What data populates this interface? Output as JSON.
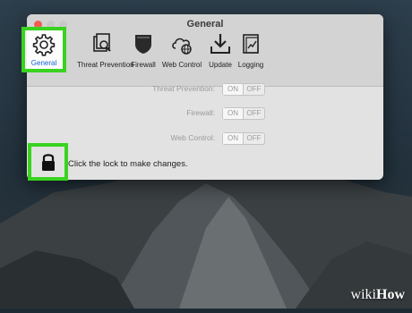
{
  "window": {
    "title": "General"
  },
  "toolbar": {
    "items": [
      {
        "label": "General",
        "icon": "gear-icon",
        "selected": true
      },
      {
        "label": "Threat Prevention",
        "icon": "magnifier-document-icon"
      },
      {
        "label": "Firewall",
        "icon": "shield-icon"
      },
      {
        "label": "Web Control",
        "icon": "cloud-globe-icon"
      },
      {
        "label": "Update",
        "icon": "download-tray-icon"
      },
      {
        "label": "Logging",
        "icon": "log-document-icon"
      }
    ]
  },
  "settings": [
    {
      "label": "Threat Prevention:",
      "on": "ON",
      "off": "OFF"
    },
    {
      "label": "Firewall:",
      "on": "ON",
      "off": "OFF"
    },
    {
      "label": "Web Control:",
      "on": "ON",
      "off": "OFF"
    }
  ],
  "lock": {
    "text": "Click the lock to make changes.",
    "icon": "lock-icon"
  },
  "watermark": {
    "wiki": "wiki",
    "how": "How"
  },
  "colors": {
    "highlight": "#39d31f",
    "selected_label": "#1761d8",
    "close_button": "#f25c54"
  }
}
